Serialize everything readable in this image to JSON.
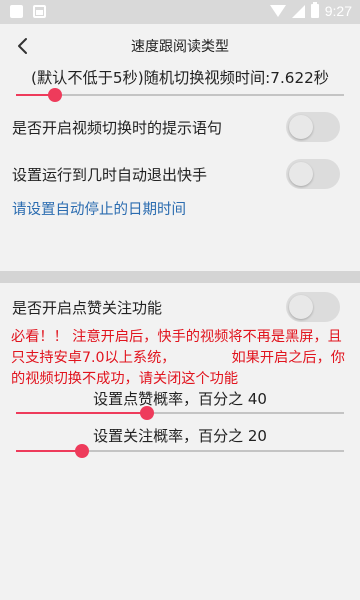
{
  "status_bar": {
    "time": "9:27",
    "icons": [
      "app-icon",
      "image-icon",
      "wifi-icon",
      "signal-icon",
      "battery-icon"
    ]
  },
  "header": {
    "title": "速度跟阅读类型",
    "back_icon": "back-arrow-icon"
  },
  "settings": {
    "switch_interval_label": "(默认不低于5秒)随机切换视频时间:7.622秒",
    "switch_interval_slider": {
      "fraction": 0.12
    },
    "prompt_switch_label": "是否开启视频切换时的提示语句",
    "prompt_switch_on": false,
    "auto_exit_label": "设置运行到几时自动退出快手",
    "auto_exit_on": false,
    "stop_date_link": "请设置自动停止的日期时间",
    "like_follow_label": "是否开启点赞关注功能",
    "like_follow_on": false,
    "warning_line1": "必看！！ 注意开启后，快手的视频将不再是黑屏，且只支持安卓7.0以上系统，",
    "warning_line2": "如果开启之后，你的视频切换不成功，请关闭这个功能",
    "like_rate_label": "设置点赞概率，百分之 40",
    "like_rate_value": 40,
    "follow_rate_label": "设置关注概率，百分之 20",
    "follow_rate_value": 20
  },
  "colors": {
    "accent": "#ee3b5b",
    "warning": "#e1141e",
    "link": "#2b6cb0",
    "background": "#f2f2f2"
  }
}
